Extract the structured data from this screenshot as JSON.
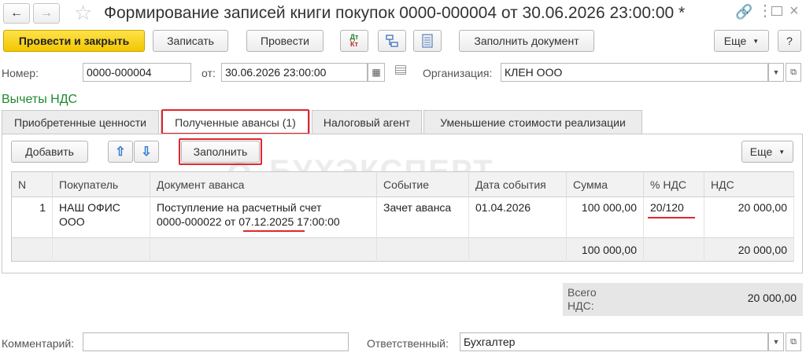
{
  "window": {
    "title": "Формирование записей книги покупок 0000-000004 от 30.06.2026 23:00:00 *"
  },
  "toolbar": {
    "post_close": "Провести и закрыть",
    "save": "Записать",
    "post": "Провести",
    "dt_label": "Дт",
    "kt_label": "Кт",
    "fill_doc": "Заполнить документ",
    "more": "Еще",
    "help": "?"
  },
  "header": {
    "number_label": "Номер:",
    "number_value": "0000-000004",
    "date_label": "от:",
    "date_value": "30.06.2026 23:00:00",
    "org_label": "Организация:",
    "org_value": "КЛЕН ООО"
  },
  "section_title": "Вычеты НДС",
  "tabs": [
    {
      "label": "Приобретенные ценности"
    },
    {
      "label": "Полученные авансы (1)"
    },
    {
      "label": "Налоговый агент"
    },
    {
      "label": "Уменьшение стоимости реализации"
    }
  ],
  "table_toolbar": {
    "add": "Добавить",
    "fill": "Заполнить",
    "more": "Еще"
  },
  "watermark": "БУХЭКСПЕРТ",
  "table": {
    "columns": [
      "N",
      "Покупатель",
      "Документ аванса",
      "Событие",
      "Дата события",
      "Сумма",
      "% НДС",
      "НДС"
    ],
    "rows": [
      {
        "n": "1",
        "buyer_1": "НАШ ОФИС",
        "buyer_2": "ООО",
        "doc_1": "Поступление на расчетный счет",
        "doc_2a": "0000-000022 от ",
        "doc_2b": "07.12.2025",
        "doc_2c": " 17:00:00",
        "event": "Зачет аванса",
        "event_date": "01.04.2026",
        "sum": "100 000,00",
        "vat_rate": "20/120",
        "vat": "20 000,00"
      }
    ],
    "totals": {
      "sum": "100 000,00",
      "vat": "20 000,00"
    }
  },
  "total_vat": {
    "label_1": "Всего",
    "label_2": "НДС:",
    "value": "20 000,00"
  },
  "footer": {
    "comment_label": "Комментарий:",
    "comment_value": "",
    "responsible_label": "Ответственный:",
    "responsible_value": "Бухгалтер"
  }
}
